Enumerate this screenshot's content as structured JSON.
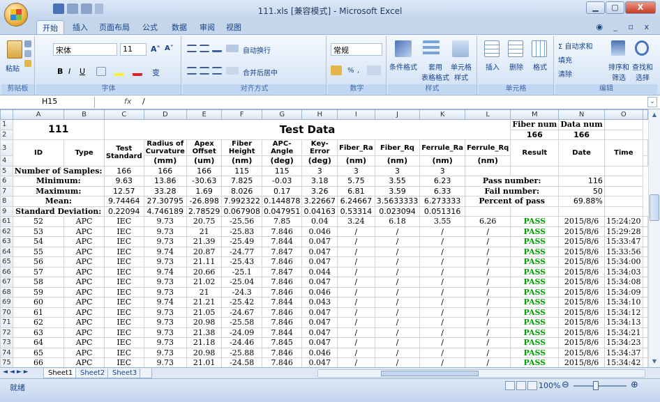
{
  "window": {
    "title": "111.xls [兼容模式] - Microsoft Excel",
    "minimize": "▁",
    "maximize": "▢",
    "close": "X"
  },
  "tabs": [
    "开始",
    "插入",
    "页面布局",
    "公式",
    "数据",
    "审阅",
    "视图"
  ],
  "tabs_right": "◉ _ ▫ x",
  "ribbon": {
    "clipboard": {
      "caption": "剪贴板",
      "paste": "粘贴"
    },
    "font": {
      "caption": "字体",
      "name": "宋体",
      "size": "11",
      "bold": "B",
      "italic": "I",
      "underline": "U",
      "grow": "A˄",
      "shrink": "A˅",
      "wen": "变"
    },
    "alignment": {
      "caption": "对齐方式",
      "wrap": "自动换行",
      "merge": "合并后居中"
    },
    "number": {
      "caption": "数字",
      "format": "常规",
      "percent": "%",
      "comma": ","
    },
    "styles": {
      "caption": "样式",
      "conditional": "条件格式",
      "table_fmt": "套用\n表格格式",
      "cell_style": "单元格\n样式"
    },
    "cells": {
      "caption": "单元格",
      "insert": "插入",
      "delete": "删除",
      "format": "格式"
    },
    "editing": {
      "caption": "编辑",
      "autosum": "Σ 自动求和",
      "fill": "填充",
      "clear": "清除",
      "sort": "排序和\n筛选",
      "find": "查找和\n选择"
    }
  },
  "formula_bar": {
    "cell": "H15",
    "fx": "fx",
    "value": "/"
  },
  "columns": [
    "A",
    "B",
    "C",
    "D",
    "E",
    "F",
    "G",
    "H",
    "I",
    "J",
    "K",
    "L",
    "M",
    "N",
    "O"
  ],
  "header": {
    "title_left": "111",
    "title_main": "Test  Data",
    "fiber_num_label": "Fiber num",
    "fiber_num_value": "166",
    "data_num_label": "Data num",
    "data_num_value": "166",
    "col_headers": [
      "ID",
      "Type",
      "Test Standard",
      "Radius of Curvature",
      "Apex Offset",
      "Fiber Height",
      "APC-Angle",
      "Key-Error",
      "Fiber_Ra",
      "Fiber_Rq",
      "Ferrule_Ra",
      "Ferrule_Rq",
      "Result",
      "Date",
      "Time"
    ],
    "units": [
      "(mm)",
      "(um)",
      "(nm)",
      "(deg)",
      "(deg)",
      "(nm)",
      "(nm)",
      "(nm)",
      "(nm)"
    ]
  },
  "stats": {
    "samples": {
      "label": "Number of Samples:",
      "values": [
        "166",
        "166",
        "166",
        "115",
        "115",
        "3",
        "3",
        "3",
        "3"
      ]
    },
    "minimum": {
      "label": "Minimum:",
      "values": [
        "9.63",
        "13.86",
        "-30.63",
        "7.825",
        "-0.03",
        "3.18",
        "5.75",
        "3.55",
        "6.23"
      ]
    },
    "maximum": {
      "label": "Maximum:",
      "values": [
        "12.57",
        "33.28",
        "1.69",
        "8.026",
        "0.17",
        "3.26",
        "6.81",
        "3.59",
        "6.33"
      ]
    },
    "mean": {
      "label": "Mean:",
      "values": [
        "9.74464",
        "27.30795",
        "-26.898",
        "7.992322",
        "0.144878",
        "3.22667",
        "6.24667",
        "3.5633333",
        "6.273333"
      ]
    },
    "stddev": {
      "label": "Standard Deviation:",
      "values": [
        "0.22094",
        "4.746189",
        "2.78529",
        "0.067908",
        "0.047951",
        "0.04163",
        "0.53314",
        "0.023094",
        "0.051316"
      ]
    }
  },
  "summary": {
    "pass_label": "Pass number:",
    "pass_value": "116",
    "fail_label": "Fail number:",
    "fail_value": "50",
    "percent_label": "Percent of pass",
    "percent_value": "69.88%"
  },
  "header_row_numbers": [
    "1",
    "2",
    "3",
    "4",
    "5",
    "6",
    "7",
    "8",
    "9"
  ],
  "rows": [
    {
      "n": "61",
      "cells": [
        "52",
        "APC",
        "IEC",
        "9.73",
        "20.75",
        "-25.56",
        "7.85",
        "0.04",
        "3.24",
        "6.18",
        "3.55",
        "6.26",
        "PASS",
        "2015/8/6",
        "15:24:20"
      ]
    },
    {
      "n": "62",
      "cells": [
        "53",
        "APC",
        "IEC",
        "9.73",
        "21",
        "-25.83",
        "7.846",
        "0.046",
        "/",
        "/",
        "/",
        "/",
        "PASS",
        "2015/8/6",
        "15:29:28"
      ]
    },
    {
      "n": "63",
      "cells": [
        "54",
        "APC",
        "IEC",
        "9.73",
        "21.39",
        "-25.49",
        "7.844",
        "0.047",
        "/",
        "/",
        "/",
        "/",
        "PASS",
        "2015/8/6",
        "15:33:47"
      ]
    },
    {
      "n": "64",
      "cells": [
        "55",
        "APC",
        "IEC",
        "9.74",
        "20.87",
        "-24.77",
        "7.847",
        "0.047",
        "/",
        "/",
        "/",
        "/",
        "PASS",
        "2015/8/6",
        "15:33:56"
      ]
    },
    {
      "n": "65",
      "cells": [
        "56",
        "APC",
        "IEC",
        "9.73",
        "21.11",
        "-25.43",
        "7.846",
        "0.047",
        "/",
        "/",
        "/",
        "/",
        "PASS",
        "2015/8/6",
        "15:34:00"
      ]
    },
    {
      "n": "66",
      "cells": [
        "57",
        "APC",
        "IEC",
        "9.74",
        "20.66",
        "-25.1",
        "7.847",
        "0.044",
        "/",
        "/",
        "/",
        "/",
        "PASS",
        "2015/8/6",
        "15:34:03"
      ]
    },
    {
      "n": "67",
      "cells": [
        "58",
        "APC",
        "IEC",
        "9.73",
        "21.02",
        "-25.04",
        "7.846",
        "0.047",
        "/",
        "/",
        "/",
        "/",
        "PASS",
        "2015/8/6",
        "15:34:08"
      ]
    },
    {
      "n": "68",
      "cells": [
        "59",
        "APC",
        "IEC",
        "9.73",
        "21",
        "-24.3",
        "7.846",
        "0.046",
        "/",
        "/",
        "/",
        "/",
        "PASS",
        "2015/8/6",
        "15:34:09"
      ]
    },
    {
      "n": "69",
      "cells": [
        "60",
        "APC",
        "IEC",
        "9.74",
        "21.21",
        "-25.42",
        "7.844",
        "0.043",
        "/",
        "/",
        "/",
        "/",
        "PASS",
        "2015/8/6",
        "15:34:10"
      ]
    },
    {
      "n": "70",
      "cells": [
        "61",
        "APC",
        "IEC",
        "9.73",
        "21.05",
        "-24.67",
        "7.846",
        "0.047",
        "/",
        "/",
        "/",
        "/",
        "PASS",
        "2015/8/6",
        "15:34:12"
      ]
    },
    {
      "n": "71",
      "cells": [
        "62",
        "APC",
        "IEC",
        "9.73",
        "20.98",
        "-25.58",
        "7.846",
        "0.047",
        "/",
        "/",
        "/",
        "/",
        "PASS",
        "2015/8/6",
        "15:34:13"
      ]
    },
    {
      "n": "72",
      "cells": [
        "63",
        "APC",
        "IEC",
        "9.73",
        "21.38",
        "-24.09",
        "7.844",
        "0.047",
        "/",
        "/",
        "/",
        "/",
        "PASS",
        "2015/8/6",
        "15:34:21"
      ]
    },
    {
      "n": "73",
      "cells": [
        "64",
        "APC",
        "IEC",
        "9.73",
        "21.18",
        "-24.46",
        "7.845",
        "0.047",
        "/",
        "/",
        "/",
        "/",
        "PASS",
        "2015/8/6",
        "15:34:23"
      ]
    },
    {
      "n": "74",
      "cells": [
        "65",
        "APC",
        "IEC",
        "9.73",
        "20.98",
        "-25.88",
        "7.846",
        "0.046",
        "/",
        "/",
        "/",
        "/",
        "PASS",
        "2015/8/6",
        "15:34:37"
      ]
    },
    {
      "n": "75",
      "cells": [
        "66",
        "APC",
        "IEC",
        "9.73",
        "21.01",
        "-24.58",
        "7.846",
        "0.047",
        "/",
        "/",
        "/",
        "/",
        "PASS",
        "2015/8/6",
        "15:34:42"
      ]
    }
  ],
  "sheet_tabs": [
    "Sheet1",
    "Sheet2",
    "Sheet3"
  ],
  "status": {
    "ready": "就绪",
    "zoom": "100%"
  },
  "colors": {
    "pass": "#00a000",
    "accent": "#15428b"
  }
}
